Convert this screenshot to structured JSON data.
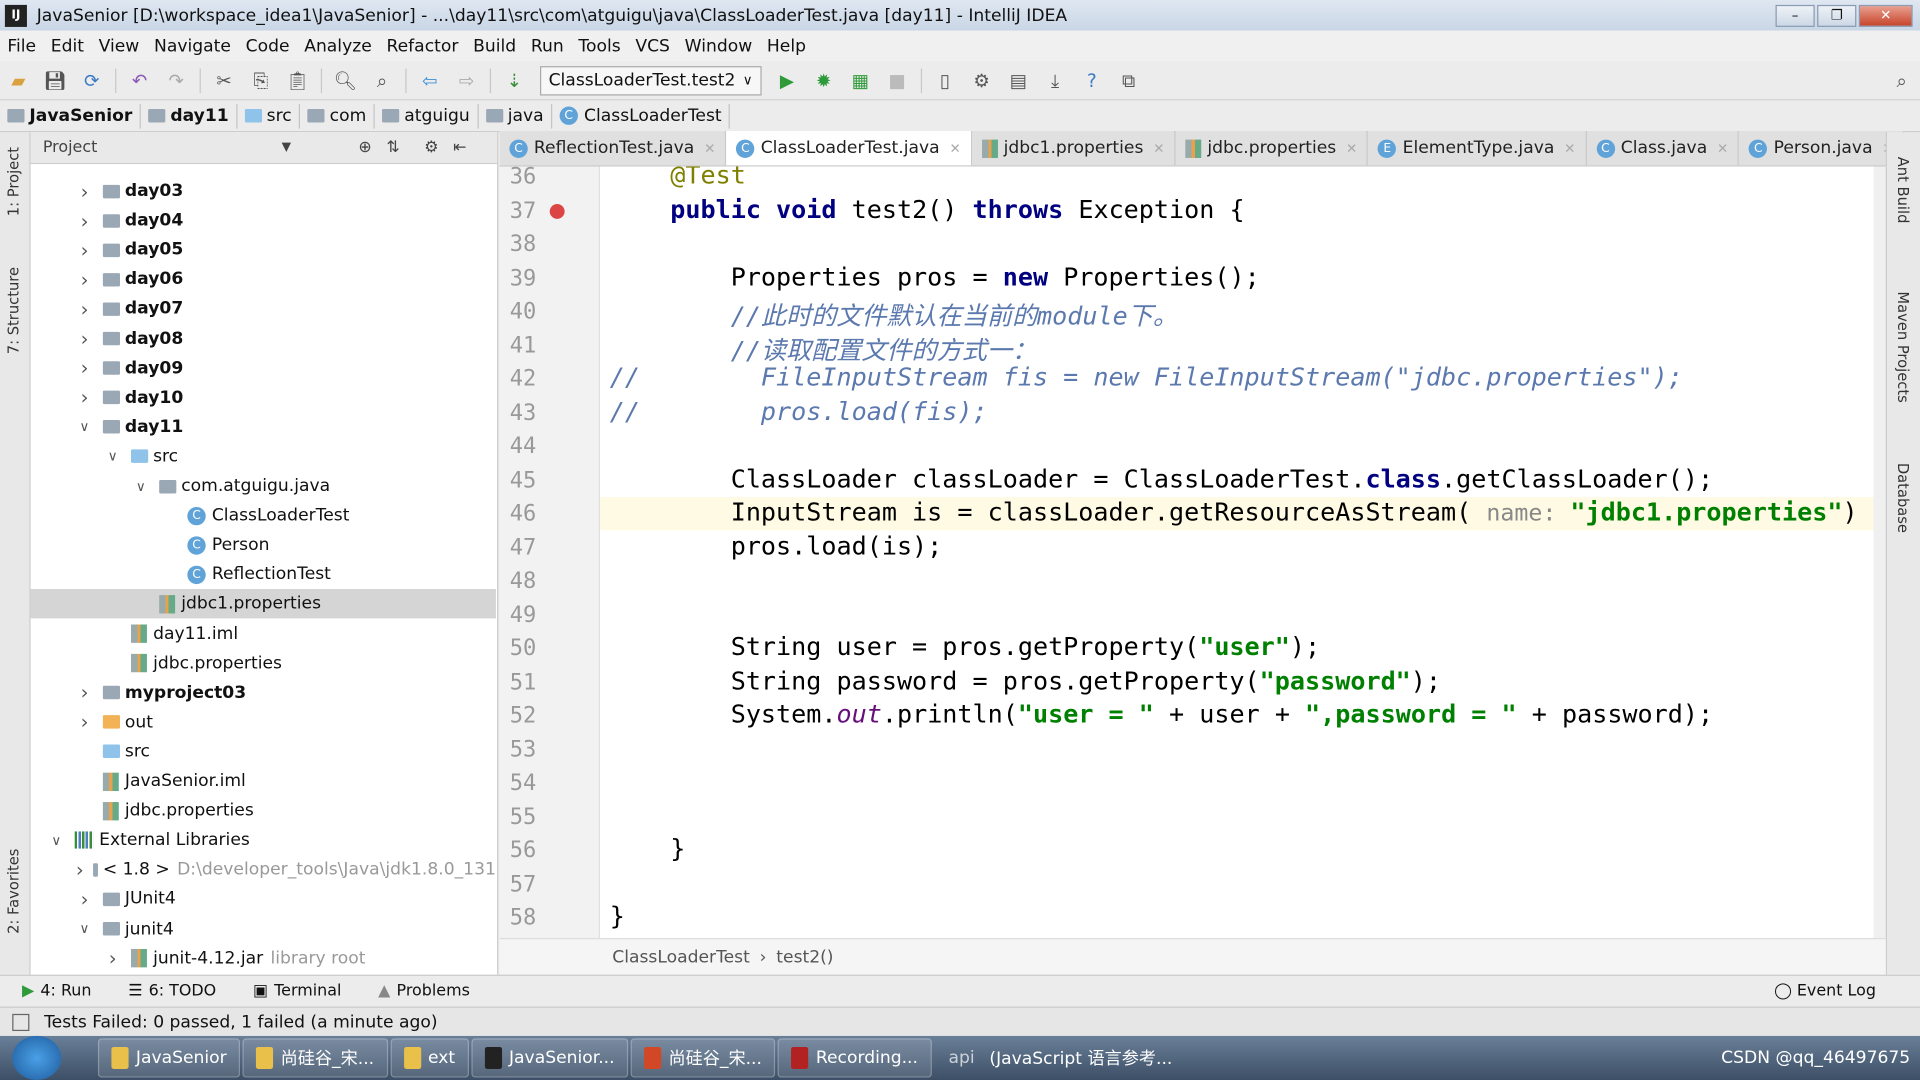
{
  "window": {
    "title": "JavaSenior [D:\\workspace_idea1\\JavaSenior] - ...\\day11\\src\\com\\atguigu\\java\\ClassLoaderTest.java [day11] - IntelliJ IDEA",
    "logo": "IJ"
  },
  "menu": [
    "File",
    "Edit",
    "View",
    "Navigate",
    "Code",
    "Analyze",
    "Refactor",
    "Build",
    "Run",
    "Tools",
    "VCS",
    "Window",
    "Help"
  ],
  "toolbar": {
    "run_config": "ClassLoaderTest.test2"
  },
  "breadcrumb": [
    "JavaSenior",
    "day11",
    "src",
    "com",
    "atguigu",
    "java",
    "ClassLoaderTest"
  ],
  "project_panel": {
    "title": "Project",
    "items": [
      {
        "label": "day03",
        "level": 1,
        "arrow": "right",
        "icon": "folder",
        "bold": true
      },
      {
        "label": "day04",
        "level": 1,
        "arrow": "right",
        "icon": "folder",
        "bold": true
      },
      {
        "label": "day05",
        "level": 1,
        "arrow": "right",
        "icon": "folder",
        "bold": true
      },
      {
        "label": "day06",
        "level": 1,
        "arrow": "right",
        "icon": "folder",
        "bold": true
      },
      {
        "label": "day07",
        "level": 1,
        "arrow": "right",
        "icon": "folder",
        "bold": true
      },
      {
        "label": "day08",
        "level": 1,
        "arrow": "right",
        "icon": "folder",
        "bold": true
      },
      {
        "label": "day09",
        "level": 1,
        "arrow": "right",
        "icon": "folder",
        "bold": true
      },
      {
        "label": "day10",
        "level": 1,
        "arrow": "right",
        "icon": "folder",
        "bold": true
      },
      {
        "label": "day11",
        "level": 1,
        "arrow": "down",
        "icon": "folder",
        "bold": true
      },
      {
        "label": "src",
        "level": 2,
        "arrow": "down",
        "icon": "folder-blue"
      },
      {
        "label": "com.atguigu.java",
        "level": 3,
        "arrow": "down",
        "icon": "folder"
      },
      {
        "label": "ClassLoaderTest",
        "level": 4,
        "icon": "class"
      },
      {
        "label": "Person",
        "level": 4,
        "icon": "class"
      },
      {
        "label": "ReflectionTest",
        "level": 4,
        "icon": "class"
      },
      {
        "label": "jdbc1.properties",
        "level": 3,
        "icon": "properties",
        "selected": true
      },
      {
        "label": "day11.iml",
        "level": 2,
        "icon": "properties"
      },
      {
        "label": "jdbc.properties",
        "level": 2,
        "icon": "properties"
      },
      {
        "label": "myproject03",
        "level": 1,
        "arrow": "right",
        "icon": "folder",
        "bold": true
      },
      {
        "label": "out",
        "level": 1,
        "arrow": "right",
        "icon": "folder-orange"
      },
      {
        "label": "src",
        "level": 1,
        "icon": "folder-blue"
      },
      {
        "label": "JavaSenior.iml",
        "level": 1,
        "icon": "properties"
      },
      {
        "label": "jdbc.properties",
        "level": 1,
        "icon": "properties"
      },
      {
        "label": "External Libraries",
        "level": 0,
        "arrow": "down",
        "icon": "library"
      },
      {
        "label": "< 1.8 >",
        "extra": "D:\\developer_tools\\Java\\jdk1.8.0_131",
        "level": 1,
        "arrow": "right",
        "icon": "folder"
      },
      {
        "label": "JUnit4",
        "level": 1,
        "arrow": "right",
        "icon": "folder"
      },
      {
        "label": "junit4",
        "level": 1,
        "arrow": "down",
        "icon": "folder"
      },
      {
        "label": "junit-4.12.jar",
        "extra": "library root",
        "level": 2,
        "arrow": "right",
        "icon": "properties"
      }
    ]
  },
  "tabs": [
    {
      "label": "ReflectionTest.java",
      "icon": "c"
    },
    {
      "label": "ClassLoaderTest.java",
      "icon": "c",
      "active": true
    },
    {
      "label": "jdbc1.properties",
      "icon": "p"
    },
    {
      "label": "jdbc.properties",
      "icon": "p"
    },
    {
      "label": "ElementType.java",
      "icon": "e"
    },
    {
      "label": "Class.java",
      "icon": "c"
    },
    {
      "label": "Person.java",
      "icon": "c"
    }
  ],
  "editor": {
    "current_line": 46,
    "lines": [
      {
        "n": "36",
        "t": [
          [
            "    @Test",
            "ann"
          ]
        ]
      },
      {
        "n": "37",
        "t": [
          [
            "    ",
            ""
          ],
          [
            "public void ",
            "kw"
          ],
          [
            "test2() ",
            ""
          ],
          [
            "throws ",
            "kw"
          ],
          [
            "Exception {",
            ""
          ]
        ]
      },
      {
        "n": "38",
        "t": []
      },
      {
        "n": "39",
        "t": [
          [
            "        Properties pros = ",
            ""
          ],
          [
            "new ",
            "kw"
          ],
          [
            "Properties();",
            ""
          ]
        ]
      },
      {
        "n": "40",
        "t": [
          [
            "        //此时的文件默认在当前的module下。",
            "cm"
          ]
        ]
      },
      {
        "n": "41",
        "t": [
          [
            "        //读取配置文件的方式一：",
            "cm"
          ]
        ]
      },
      {
        "n": "42",
        "t": [
          [
            "//        FileInputStream fis = new FileInputStream(\"jdbc.properties\");",
            "cm"
          ]
        ]
      },
      {
        "n": "43",
        "t": [
          [
            "//        pros.load(fis);",
            "cm"
          ]
        ]
      },
      {
        "n": "44",
        "t": []
      },
      {
        "n": "45",
        "t": [
          [
            "        ClassLoader classLoader = ClassLoaderTest.",
            ""
          ],
          [
            "class",
            "kw"
          ],
          [
            ".getClassLoader();",
            ""
          ]
        ]
      },
      {
        "n": "46",
        "t": [
          [
            "        InputStream is = classLoader.getResourceAsStream( ",
            ""
          ],
          [
            "name: ",
            "hint"
          ],
          [
            "\"jdbc1.properties\"",
            "str"
          ],
          [
            ")",
            ""
          ]
        ]
      },
      {
        "n": "47",
        "t": [
          [
            "        pros.load(is);",
            ""
          ]
        ]
      },
      {
        "n": "48",
        "t": []
      },
      {
        "n": "49",
        "t": []
      },
      {
        "n": "50",
        "t": [
          [
            "        String user = pros.getProperty(",
            ""
          ],
          [
            "\"user\"",
            "str"
          ],
          [
            ");",
            ""
          ]
        ]
      },
      {
        "n": "51",
        "t": [
          [
            "        String password = pros.getProperty(",
            ""
          ],
          [
            "\"password\"",
            "str"
          ],
          [
            ");",
            ""
          ]
        ]
      },
      {
        "n": "52",
        "t": [
          [
            "        System.",
            ""
          ],
          [
            "out",
            "st"
          ],
          [
            ".println(",
            ""
          ],
          [
            "\"user = \"",
            "str"
          ],
          [
            " + user + ",
            ""
          ],
          [
            "\",password = \"",
            "str"
          ],
          [
            " + password);",
            ""
          ]
        ]
      },
      {
        "n": "53",
        "t": []
      },
      {
        "n": "54",
        "t": []
      },
      {
        "n": "55",
        "t": []
      },
      {
        "n": "56",
        "t": [
          [
            "    }",
            ""
          ]
        ]
      },
      {
        "n": "57",
        "t": []
      },
      {
        "n": "58",
        "t": [
          [
            "}",
            ""
          ]
        ]
      }
    ]
  },
  "editor_breadcrumb": [
    "ClassLoaderTest",
    "test2()"
  ],
  "left_strip": [
    "1: Project",
    "7: Structure",
    "2: Favorites"
  ],
  "right_strip": [
    "Ant Build",
    "Maven Projects",
    "Database"
  ],
  "tool_windows": [
    "4: Run",
    "6: TODO",
    "Terminal",
    "Problems"
  ],
  "event_log": "Event Log",
  "status": "Tests Failed: 0 passed, 1 failed (a minute ago)",
  "taskbar": {
    "items": [
      {
        "label": "JavaSenior",
        "color": "#e8c04a"
      },
      {
        "label": "尚硅谷_宋...",
        "color": "#e8c04a"
      },
      {
        "label": "ext",
        "color": "#e8c04a"
      },
      {
        "label": "JavaSenior...",
        "color": "#222222"
      },
      {
        "label": "尚硅谷_宋...",
        "color": "#d24726"
      },
      {
        "label": "Recording...",
        "color": "#b22222"
      }
    ],
    "extra": [
      "api",
      "(JavaScript 语言参考..."
    ],
    "tray_text": "CSDN @qq_46497675"
  }
}
